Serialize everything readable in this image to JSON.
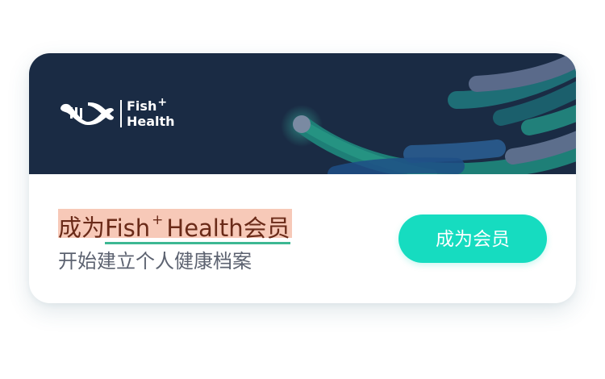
{
  "brand": {
    "name_line1": "Fish",
    "name_plus": "+",
    "name_line2": "Health"
  },
  "membership": {
    "title_prefix": "成为",
    "title_brand": "Fish",
    "title_plus": "+",
    "title_suffix": "Health会员",
    "subtitle": "开始建立个人健康档案",
    "button_label": "成为会员"
  },
  "colors": {
    "banner": "#1a2b44",
    "accent": "#16dcc0",
    "highlight": "#f7c9b8"
  },
  "icons": {
    "logo": "fish-dna-logo-icon",
    "decoration": "wave-lines-decoration-icon"
  }
}
